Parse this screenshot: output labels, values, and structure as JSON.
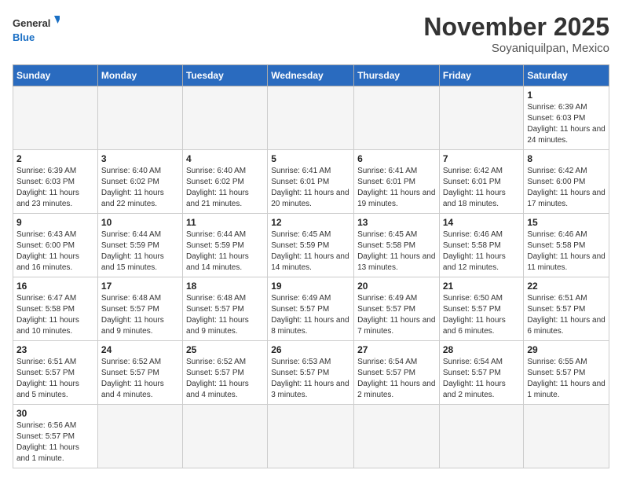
{
  "header": {
    "logo_general": "General",
    "logo_blue": "Blue",
    "month": "November 2025",
    "location": "Soyaniquilpan, Mexico"
  },
  "days_of_week": [
    "Sunday",
    "Monday",
    "Tuesday",
    "Wednesday",
    "Thursday",
    "Friday",
    "Saturday"
  ],
  "weeks": [
    [
      {
        "day": "",
        "empty": true
      },
      {
        "day": "",
        "empty": true
      },
      {
        "day": "",
        "empty": true
      },
      {
        "day": "",
        "empty": true
      },
      {
        "day": "",
        "empty": true
      },
      {
        "day": "",
        "empty": true
      },
      {
        "day": "1",
        "info": "Sunrise: 6:39 AM\nSunset: 6:03 PM\nDaylight: 11 hours and 24 minutes."
      }
    ],
    [
      {
        "day": "2",
        "info": "Sunrise: 6:39 AM\nSunset: 6:03 PM\nDaylight: 11 hours and 23 minutes."
      },
      {
        "day": "3",
        "info": "Sunrise: 6:40 AM\nSunset: 6:02 PM\nDaylight: 11 hours and 22 minutes."
      },
      {
        "day": "4",
        "info": "Sunrise: 6:40 AM\nSunset: 6:02 PM\nDaylight: 11 hours and 21 minutes."
      },
      {
        "day": "5",
        "info": "Sunrise: 6:41 AM\nSunset: 6:01 PM\nDaylight: 11 hours and 20 minutes."
      },
      {
        "day": "6",
        "info": "Sunrise: 6:41 AM\nSunset: 6:01 PM\nDaylight: 11 hours and 19 minutes."
      },
      {
        "day": "7",
        "info": "Sunrise: 6:42 AM\nSunset: 6:01 PM\nDaylight: 11 hours and 18 minutes."
      },
      {
        "day": "8",
        "info": "Sunrise: 6:42 AM\nSunset: 6:00 PM\nDaylight: 11 hours and 17 minutes."
      }
    ],
    [
      {
        "day": "9",
        "info": "Sunrise: 6:43 AM\nSunset: 6:00 PM\nDaylight: 11 hours and 16 minutes."
      },
      {
        "day": "10",
        "info": "Sunrise: 6:44 AM\nSunset: 5:59 PM\nDaylight: 11 hours and 15 minutes."
      },
      {
        "day": "11",
        "info": "Sunrise: 6:44 AM\nSunset: 5:59 PM\nDaylight: 11 hours and 14 minutes."
      },
      {
        "day": "12",
        "info": "Sunrise: 6:45 AM\nSunset: 5:59 PM\nDaylight: 11 hours and 14 minutes."
      },
      {
        "day": "13",
        "info": "Sunrise: 6:45 AM\nSunset: 5:58 PM\nDaylight: 11 hours and 13 minutes."
      },
      {
        "day": "14",
        "info": "Sunrise: 6:46 AM\nSunset: 5:58 PM\nDaylight: 11 hours and 12 minutes."
      },
      {
        "day": "15",
        "info": "Sunrise: 6:46 AM\nSunset: 5:58 PM\nDaylight: 11 hours and 11 minutes."
      }
    ],
    [
      {
        "day": "16",
        "info": "Sunrise: 6:47 AM\nSunset: 5:58 PM\nDaylight: 11 hours and 10 minutes."
      },
      {
        "day": "17",
        "info": "Sunrise: 6:48 AM\nSunset: 5:57 PM\nDaylight: 11 hours and 9 minutes."
      },
      {
        "day": "18",
        "info": "Sunrise: 6:48 AM\nSunset: 5:57 PM\nDaylight: 11 hours and 9 minutes."
      },
      {
        "day": "19",
        "info": "Sunrise: 6:49 AM\nSunset: 5:57 PM\nDaylight: 11 hours and 8 minutes."
      },
      {
        "day": "20",
        "info": "Sunrise: 6:49 AM\nSunset: 5:57 PM\nDaylight: 11 hours and 7 minutes."
      },
      {
        "day": "21",
        "info": "Sunrise: 6:50 AM\nSunset: 5:57 PM\nDaylight: 11 hours and 6 minutes."
      },
      {
        "day": "22",
        "info": "Sunrise: 6:51 AM\nSunset: 5:57 PM\nDaylight: 11 hours and 6 minutes."
      }
    ],
    [
      {
        "day": "23",
        "info": "Sunrise: 6:51 AM\nSunset: 5:57 PM\nDaylight: 11 hours and 5 minutes."
      },
      {
        "day": "24",
        "info": "Sunrise: 6:52 AM\nSunset: 5:57 PM\nDaylight: 11 hours and 4 minutes."
      },
      {
        "day": "25",
        "info": "Sunrise: 6:52 AM\nSunset: 5:57 PM\nDaylight: 11 hours and 4 minutes."
      },
      {
        "day": "26",
        "info": "Sunrise: 6:53 AM\nSunset: 5:57 PM\nDaylight: 11 hours and 3 minutes."
      },
      {
        "day": "27",
        "info": "Sunrise: 6:54 AM\nSunset: 5:57 PM\nDaylight: 11 hours and 2 minutes."
      },
      {
        "day": "28",
        "info": "Sunrise: 6:54 AM\nSunset: 5:57 PM\nDaylight: 11 hours and 2 minutes."
      },
      {
        "day": "29",
        "info": "Sunrise: 6:55 AM\nSunset: 5:57 PM\nDaylight: 11 hours and 1 minute."
      }
    ],
    [
      {
        "day": "30",
        "info": "Sunrise: 6:56 AM\nSunset: 5:57 PM\nDaylight: 11 hours and 1 minute."
      },
      {
        "day": "",
        "empty": true
      },
      {
        "day": "",
        "empty": true
      },
      {
        "day": "",
        "empty": true
      },
      {
        "day": "",
        "empty": true
      },
      {
        "day": "",
        "empty": true
      },
      {
        "day": "",
        "empty": true
      }
    ]
  ]
}
